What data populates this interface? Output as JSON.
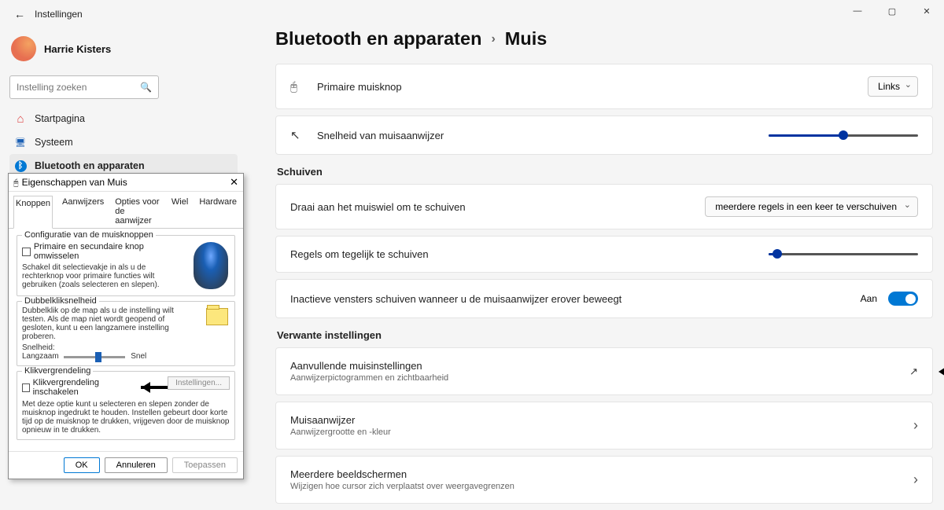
{
  "window": {
    "app_title": "Instellingen"
  },
  "profile": {
    "name": "Harrie Kisters",
    "email": ""
  },
  "search": {
    "placeholder": "Instelling zoeken"
  },
  "nav": {
    "home": "Startpagina",
    "system": "Systeem",
    "bluetooth": "Bluetooth en apparaten"
  },
  "breadcrumb": {
    "parent": "Bluetooth en apparaten",
    "current": "Muis"
  },
  "mouse": {
    "primary_label": "Primaire muisknop",
    "primary_value": "Links",
    "speed_label": "Snelheid van muisaanwijzer"
  },
  "scroll": {
    "heading": "Schuiven",
    "wheel_label": "Draai aan het muiswiel om te schuiven",
    "wheel_value": "meerdere regels in een keer te verschuiven",
    "lines_label": "Regels om tegelijk te schuiven",
    "inactive_label": "Inactieve vensters schuiven wanneer u de muisaanwijzer erover beweegt",
    "inactive_state": "Aan"
  },
  "related": {
    "heading": "Verwante instellingen",
    "additional": "Aanvullende muisinstellingen",
    "additional_sub": "Aanwijzerpictogrammen en zichtbaarheid",
    "pointer": "Muisaanwijzer",
    "pointer_sub": "Aanwijzergrootte en -kleur",
    "displays": "Meerdere beeldschermen",
    "displays_sub": "Wijzigen hoe cursor zich verplaatst over weergavegrenzen"
  },
  "dialog": {
    "title": "Eigenschappen van Muis",
    "tabs": {
      "t1": "Knoppen",
      "t2": "Aanwijzers",
      "t3": "Opties voor de aanwijzer",
      "t4": "Wiel",
      "t5": "Hardware"
    },
    "conf_legend": "Configuratie van de muisknoppen",
    "swap_label": "Primaire en secundaire knop omwisselen",
    "swap_desc": "Schakel dit selectievakje in als u de rechterknop voor primaire functies wilt gebruiken (zoals selecteren en slepen).",
    "dbl_legend": "Dubbelkliksnelheid",
    "dbl_desc": "Dubbelklik op de map als u de instelling wilt testen. Als de map niet wordt geopend of gesloten, kunt u een langzamere instelling proberen.",
    "speed_word": "Snelheid:",
    "slow": "Langzaam",
    "fast": "Snel",
    "lock_legend": "Klikvergrendeling",
    "lock_enable": "Klikvergrendeling inschakelen",
    "lock_settings": "Instellingen...",
    "lock_desc": "Met deze optie kunt u selecteren en slepen zonder de muisknop ingedrukt te houden. Instellen gebeurt door korte tijd op de muisknop te drukken, vrijgeven door de muisknop opnieuw in te drukken.",
    "ok": "OK",
    "cancel": "Annuleren",
    "apply": "Toepassen"
  }
}
